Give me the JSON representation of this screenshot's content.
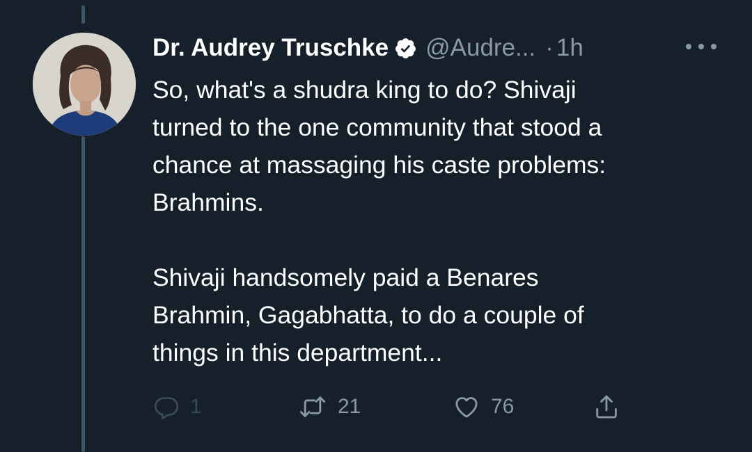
{
  "tweet": {
    "author_name": "Dr. Audrey Truschke",
    "handle": "@Audre...",
    "separator": "·",
    "time": "1h",
    "verified_icon": "verified-badge-icon",
    "more_icon": "more-options-icon",
    "text_paragraphs": [
      [
        "So, what's a shudra king to do? Shivaji",
        "turned to the one community that stood a",
        "chance at massaging his caste problems:",
        "Brahmins."
      ],
      [
        "Shivaji handsomely paid a Benares",
        "Brahmin, Gagabhatta, to do a couple of",
        "things in this department..."
      ]
    ],
    "actions": {
      "reply": {
        "icon": "reply-icon",
        "count": "1"
      },
      "retweet": {
        "icon": "retweet-icon",
        "count": "21"
      },
      "like": {
        "icon": "like-icon",
        "count": "76"
      },
      "share": {
        "icon": "share-icon"
      }
    }
  },
  "colors": {
    "background": "#15202b",
    "primary_text": "#ffffff",
    "secondary_text": "#8b98a5",
    "thread_line": "#3d5466"
  }
}
